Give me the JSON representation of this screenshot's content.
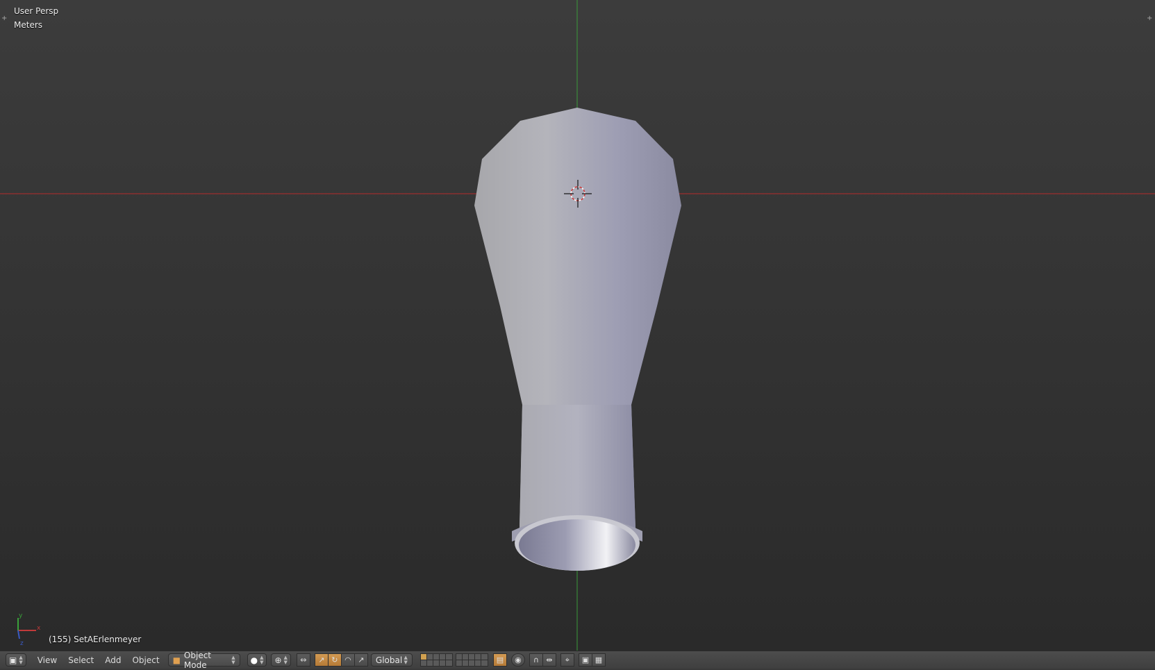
{
  "viewport": {
    "view_name": "User Persp",
    "units": "Meters",
    "object_info": "(155) SetAErlenmeyer",
    "colors": {
      "x_axis": "#b52b2b",
      "y_axis": "#3a9a3a",
      "object": "#a8a8b8"
    }
  },
  "axis_gizmo": {
    "x_label": "x",
    "y_label": "y",
    "z_label": "z"
  },
  "header": {
    "editor_icon": "3d-view-icon",
    "menus": [
      "View",
      "Select",
      "Add",
      "Object"
    ],
    "mode": "Object Mode",
    "viewport_shading_icon": "solid-sphere-icon",
    "pivot_icon": "pivot-point-icon",
    "manipulator_icons": [
      "manipulator-toggle-icon",
      "translate-icon",
      "rotate-icon",
      "scale-icon"
    ],
    "orientation": "Global",
    "layer_rows": 2,
    "layer_cols": 10,
    "snap_icons": [
      "lock-layers-icon",
      "proportional-edit-icon",
      "snap-magnet-icon",
      "snap-element-icon",
      "snap-target-icon"
    ],
    "render_icons": [
      "opengl-render-icon",
      "opengl-animation-icon"
    ]
  }
}
